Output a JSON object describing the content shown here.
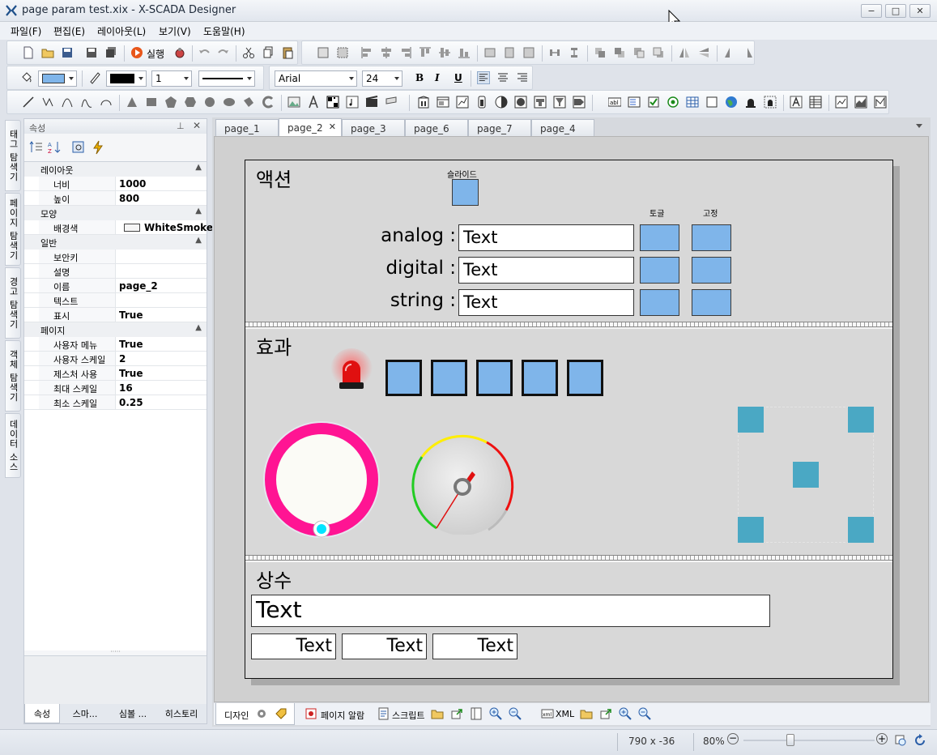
{
  "window": {
    "title": "page param test.xix - X-SCADA Designer",
    "minimize": "−",
    "maximize": "□",
    "close": "✕"
  },
  "menu": [
    "파일(F)",
    "편집(E)",
    "레이아웃(L)",
    "보기(V)",
    "도움말(H)"
  ],
  "toolbar": {
    "run_label": "실행",
    "font_name": "Arial",
    "font_size": "24",
    "line_width": "1",
    "bold": "B",
    "italic": "I",
    "underline": "U"
  },
  "left_tabs": [
    "태그 탐색기",
    "페이지 탐색기",
    "경고 탐색기",
    "객체 탐색기",
    "데이터 소스"
  ],
  "properties": {
    "title": "속성",
    "categories": [
      {
        "name": "레이아웃",
        "rows": [
          {
            "key": "너비",
            "value": "1000"
          },
          {
            "key": "높이",
            "value": "800"
          }
        ]
      },
      {
        "name": "모양",
        "rows": [
          {
            "key": "배경색",
            "value": "WhiteSmoke"
          }
        ]
      },
      {
        "name": "일반",
        "rows": [
          {
            "key": "보안키",
            "value": ""
          },
          {
            "key": "설명",
            "value": ""
          },
          {
            "key": "이름",
            "value": "page_2"
          },
          {
            "key": "텍스트",
            "value": ""
          },
          {
            "key": "표시",
            "value": "True"
          }
        ]
      },
      {
        "name": "페이지",
        "rows": [
          {
            "key": "사용자 메뉴",
            "value": "True"
          },
          {
            "key": "사용자 스케일",
            "value": "2"
          },
          {
            "key": "제스처 사용",
            "value": "True"
          },
          {
            "key": "최대 스케일",
            "value": "16"
          },
          {
            "key": "최소 스케일",
            "value": "0.25"
          }
        ]
      }
    ],
    "bottom_tabs": [
      "속성",
      "스마...",
      "심볼 ...",
      "히스토리"
    ]
  },
  "page_tabs": [
    "page_1",
    "page_2",
    "page_3",
    "page_6",
    "page_7",
    "page_4"
  ],
  "active_tab": "page_2",
  "design": {
    "action": {
      "title": "액션",
      "slider_label": "슬라이드",
      "toggle_label": "토글",
      "fixed_label": "고정",
      "rows": [
        {
          "label": "analog :",
          "value": "Text"
        },
        {
          "label": "digital :",
          "value": "Text"
        },
        {
          "label": "string :",
          "value": "Text"
        }
      ]
    },
    "effect": {
      "title": "효과"
    },
    "constant": {
      "title": "상수",
      "big_text": "Text",
      "small_texts": [
        "Text",
        "Text",
        "Text"
      ]
    }
  },
  "bottom_bar": {
    "design": "디자인",
    "page_alarm": "페이지 알람",
    "script": "스크립트",
    "xml": "XML"
  },
  "status": {
    "coords": "790 x -36",
    "zoom": "80%"
  },
  "colors": {
    "accent_blue": "#7fb5ea",
    "teal": "#4aa8c4",
    "knob_pink": "#ff1493",
    "alarm_red": "#e01010"
  }
}
